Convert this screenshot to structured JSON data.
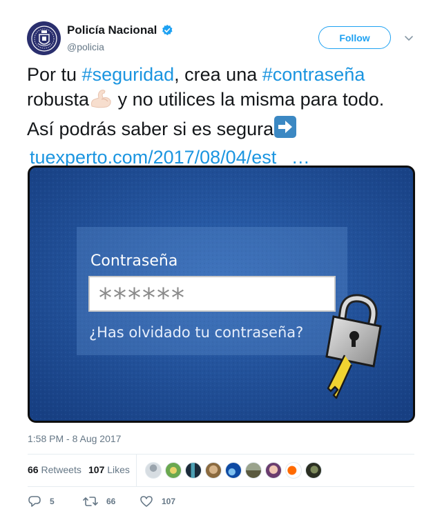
{
  "user": {
    "display_name": "Policía Nacional",
    "handle": "@policia",
    "avatar_icon": "police-badge-icon",
    "verified_icon": "verified-badge-icon"
  },
  "follow_label": "Follow",
  "tweet": {
    "part1": "Por tu ",
    "hashtag1": "#seguridad",
    "part2": ", crea una ",
    "hashtag2": "#contraseña",
    "part3": "robusta",
    "emoji1": "flexed-biceps-emoji",
    "part4": " y no utilices la misma para todo.",
    "part5": "Así podrás saber si es segura",
    "emoji2": "right-arrow-emoji",
    "link": "tuexperto.com/2017/08/04/est",
    "ellipsis": "…"
  },
  "media": {
    "label": "Contraseña",
    "password_mask": "******",
    "forgot_text": "¿Has olvidado tu contraseña?",
    "icons": [
      "padlock-icon",
      "key-icon"
    ]
  },
  "timestamp": "1:58 PM - 8 Aug 2017",
  "stats": {
    "retweets_count": "66",
    "retweets_label": "Retweets",
    "likes_count": "107",
    "likes_label": "Likes"
  },
  "actions": {
    "replies": "5",
    "retweets": "66",
    "likes": "107"
  },
  "colors": {
    "accent": "#1da1f2",
    "hashtag": "#1b95e0",
    "muted": "#657786",
    "media_bg": "#1f4e99"
  }
}
